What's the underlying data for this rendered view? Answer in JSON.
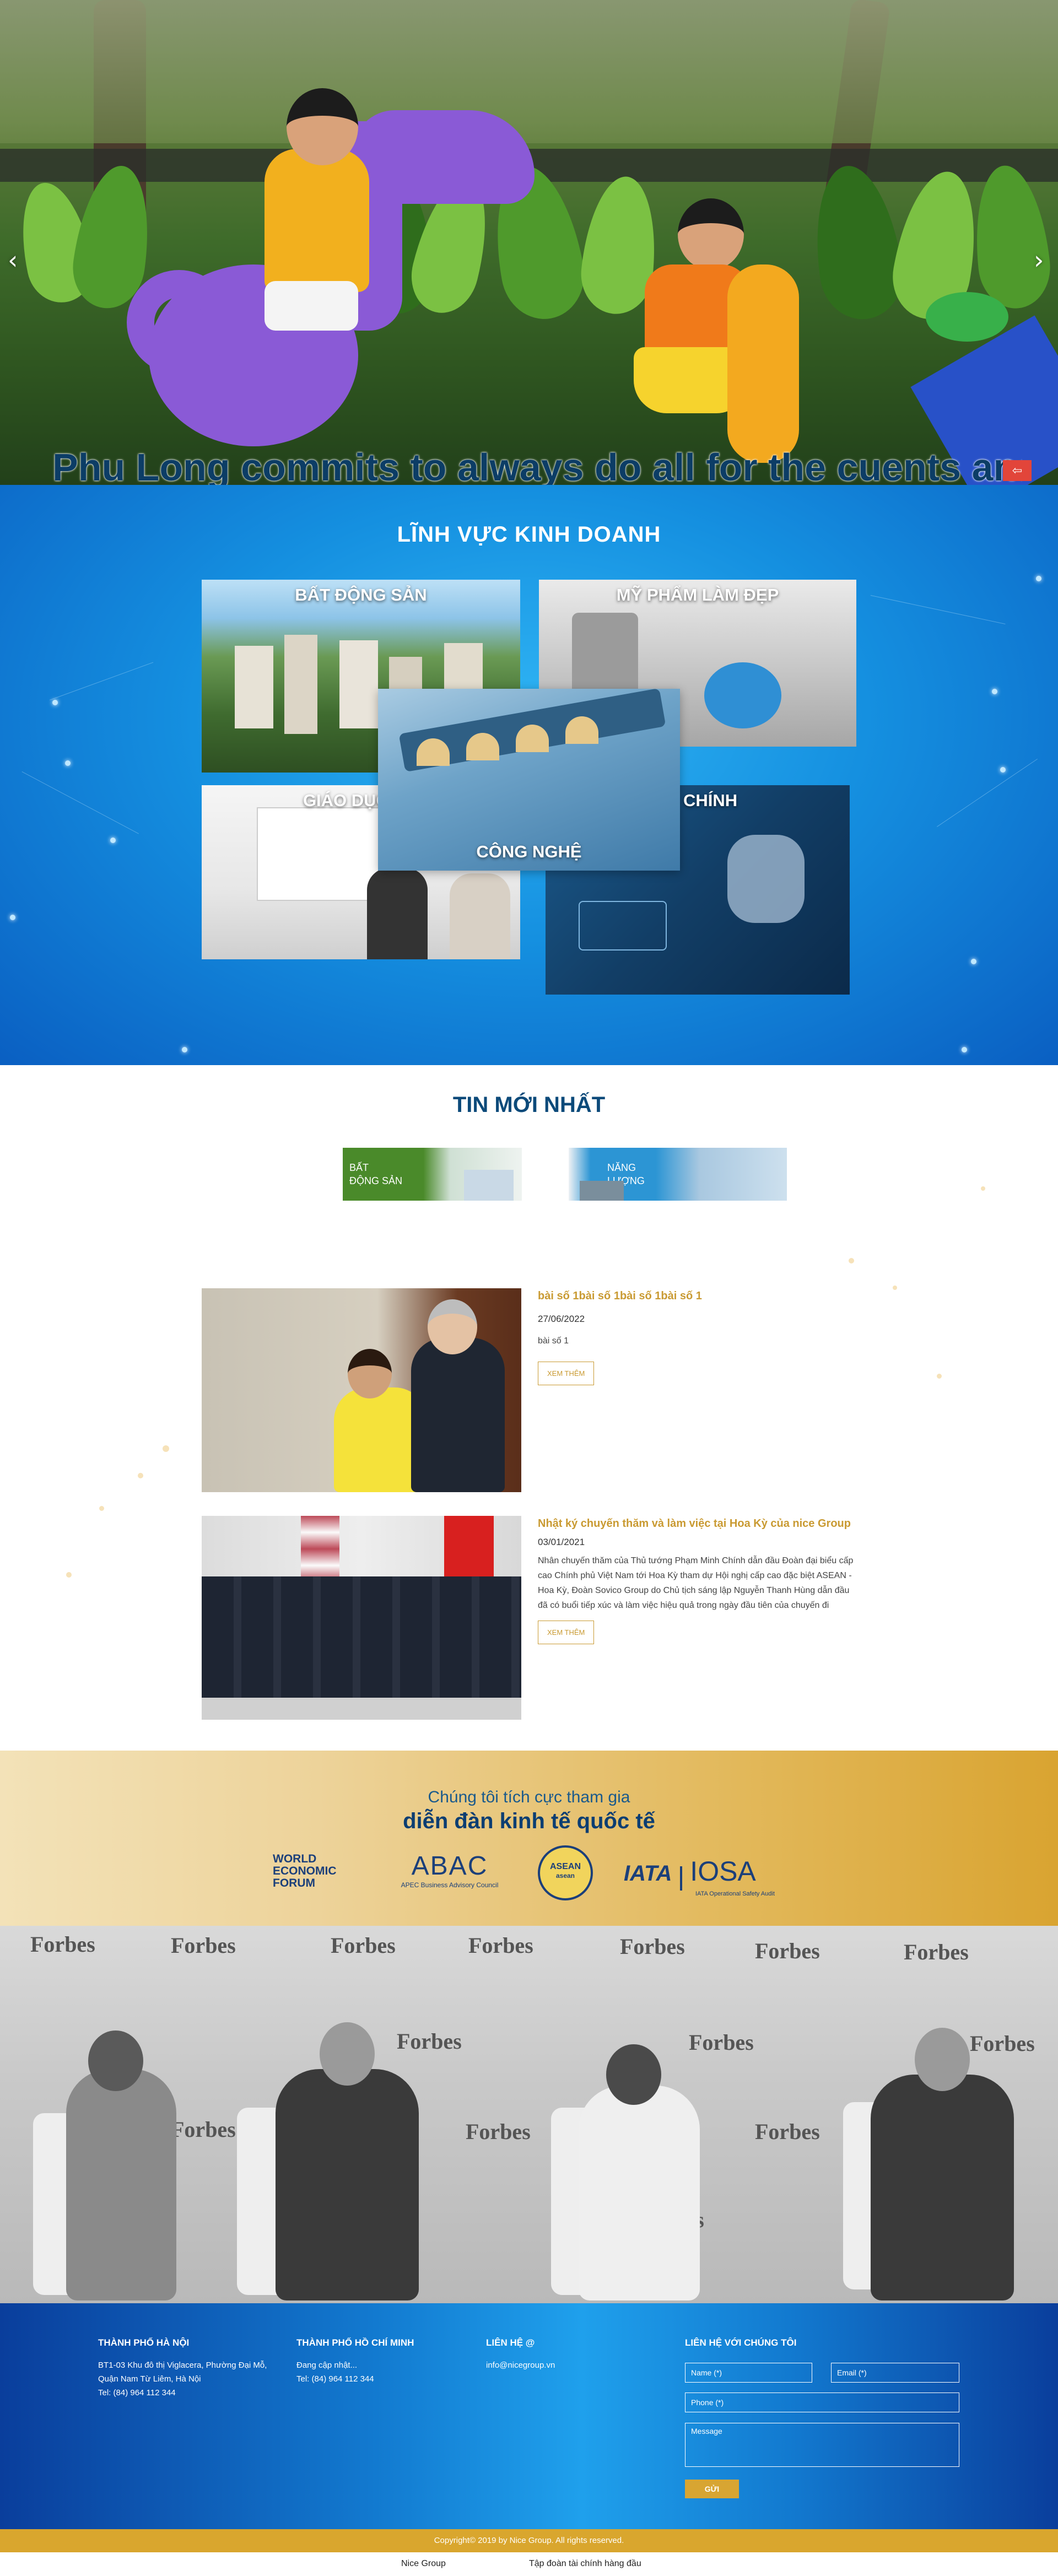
{
  "hero": {
    "caption": "Phu Long commits to always do all for the cuents and",
    "prev_icon": "chevron-left-icon",
    "next_icon": "chevron-right-icon",
    "badge_icon": "arrows-icon",
    "badge_glyph": "⇦"
  },
  "business": {
    "title": "LĨNH VỰC KINH DOANH",
    "tiles": [
      {
        "label": "BẤT ĐỘNG SẢN"
      },
      {
        "label": "MỸ PHẨM LÀM ĐẸP"
      },
      {
        "label": "GIÁO DỤC CO"
      },
      {
        "label": "CHÍNH"
      },
      {
        "label": "CÔNG NGHỆ"
      }
    ]
  },
  "news": {
    "title": "TIN MỚI NHẤT",
    "tabs": [
      {
        "label_line1": "BẤT",
        "label_line2": "ĐỘNG SẢN"
      },
      {
        "label_line1": "NĂNG",
        "label_line2": "LƯỢNG"
      }
    ],
    "items": [
      {
        "headline": "bài số 1bài số 1bài số 1bài số 1",
        "date": "27/06/2022",
        "excerpt": "bài số 1",
        "button": "XEM THÊM"
      },
      {
        "headline": "Nhật ký chuyến thăm và làm việc tại Hoa Kỳ của nice Group",
        "date": "03/01/2021",
        "excerpt": "Nhân chuyến thăm của Thủ tướng Phạm Minh Chính dẫn đầu Đoàn đại biểu cấp cao Chính phủ Việt Nam tới Hoa Kỳ tham dự Hội nghị cấp cao đặc biệt ASEAN - Hoa Kỳ, Đoàn Sovico Group do Chủ tịch sáng lập Nguyễn Thanh Hùng dẫn đầu đã có buổi tiếp xúc và làm việc hiệu quả trong ngày đầu tiên của chuyến đi",
        "button": "XEM THÊM"
      }
    ]
  },
  "forum": {
    "subtitle": "Chúng tôi tích cực tham gia",
    "title": "diễn đàn kinh tế quốc tế",
    "logos": [
      {
        "line1": "WORLD",
        "line2": "ECONOMIC",
        "line3": "FORUM"
      },
      {
        "main": "ABAC",
        "sub": "APEC Business Advisory Council"
      },
      {
        "main": "ASEAN",
        "sub": "asean"
      },
      {
        "main": "IATA",
        "second": "IOSA",
        "sub": "IATA Operational Safety Audit"
      }
    ]
  },
  "panel": {
    "brand": "Forbes"
  },
  "footer": {
    "hanoi": {
      "title": "THÀNH PHỐ HÀ NỘI",
      "line1": "BT1-03 Khu đô thị Viglacera, Phường Đại Mỗ,",
      "line2": "Quận Nam Từ Liêm, Hà Nội",
      "line3": "Tel: (84) 964 112 344"
    },
    "hcm": {
      "title": "THÀNH PHỐ HỒ CHÍ MINH",
      "line1": "Đang cập nhật...",
      "line2": "Tel: (84) 964 112 344"
    },
    "contact": {
      "title": "LIÊN HỆ @",
      "email": "info@nicegroup.vn"
    },
    "form": {
      "title": "LIÊN HỆ VỚI CHÚNG TÔI",
      "name_placeholder": "Name (*)",
      "email_placeholder": "Email (*)",
      "phone_placeholder": "Phone (*)",
      "message_placeholder": "Message",
      "send_label": "GỬI"
    }
  },
  "copyright": "Copyright© 2019 by Nice Group. All rights reserved.",
  "bottom_links": [
    "Nice Group",
    "Tập đoàn tài chính hàng đầu"
  ],
  "colors": {
    "blue": "#1590e0",
    "gold": "#d9a62e",
    "navy": "#0c4a7a"
  }
}
